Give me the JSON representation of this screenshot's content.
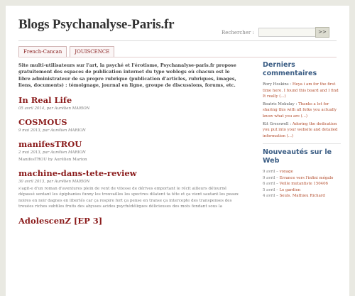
{
  "site": {
    "title": "Blogs Psychanalyse-Paris.fr"
  },
  "search": {
    "label": "Rechercher :",
    "value": "",
    "button_label": ">>"
  },
  "nav": {
    "tabs": [
      {
        "label": "French-Cancan"
      },
      {
        "label": "JOUISCENCE"
      }
    ]
  },
  "main": {
    "intro": "Site multi-utilisateurs sur l'art, la psyché et l'érotisme, Psychanalyse-paris.fr propose gratuitement des espaces de publication internet du type weblogs où chacun est le libre administrateur de sa propre rubrique (publication d'articles, rubriques, images, liens, documents) : témoignage, journal en ligne, groupe de discussions, forums, etc.",
    "posts": [
      {
        "title": "In Real Life",
        "meta": "05 avril 2014, par Aurélien MARION",
        "excerpt": ""
      },
      {
        "title": "COSMOUS",
        "meta": "9 mai 2013, par Aurélien MARION",
        "excerpt": ""
      },
      {
        "title": "manifesTROU",
        "meta": "2 mai 2013, par Aurélien MARION",
        "excerpt": "ManifesTROU by Aurélien Marion"
      },
      {
        "title": "machine-dans-tete-review",
        "meta": "30 avril 2013, par Aurélien MARION",
        "excerpt": "s'agit-e d'un roman d'aventures plein de vent de vitesse de dérives emportant le récit ailleurs détourné dépassé sentant les épiphanies funny les trouvailles les spectres dilatent ta tête et ça vient sautant les peaux noires en noir dagnes en libertés car ça respire fort ça pense en transe ça intercepte des transpenses des trouées riches subtiles fruits des abysses acides psychédéliques délicieuses des mots fondant sous la"
      },
      {
        "title": "AdolescenZ [EP 3]",
        "meta": "",
        "excerpt": ""
      }
    ]
  },
  "sidebar": {
    "comments_heading": "Derniers commentaires",
    "comments": [
      {
        "author": "Rory Hoskins :",
        "text": "Heya i am for the first time here. I found this board and I find It really (...)"
      },
      {
        "author": "Beatris Mokulay :",
        "text": "Thanks a lot for sharing this with all folks you actually know what you are (...)"
      },
      {
        "author": "Kit Gresswell :",
        "text": "Adoring the dedication you put into your website and detailed information (...)"
      }
    ],
    "news_heading": "Nouveautés sur le Web",
    "news": [
      {
        "date": "9 avril –",
        "title": "voyage"
      },
      {
        "date": "9 avril –",
        "title": "Errance vers l'infini mégalo"
      },
      {
        "date": "6 avril –",
        "title": "Veille mutantiste 150406"
      },
      {
        "date": "5 avril –",
        "title": "Le gardien"
      },
      {
        "date": "4 avril –",
        "title": "Seuls. Mathieu Richard"
      }
    ]
  }
}
